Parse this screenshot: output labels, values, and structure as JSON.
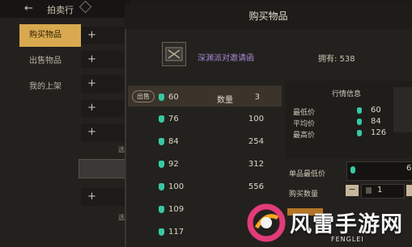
{
  "left_panel": {
    "title": "拍卖行",
    "back_icon": "←",
    "tabs": [
      {
        "label": "购买物品",
        "active": true
      },
      {
        "label": "出售物品",
        "active": false
      },
      {
        "label": "我的上架",
        "active": false
      }
    ],
    "fragments": [
      "选",
      "选"
    ]
  },
  "dialog": {
    "title": "购买物品",
    "item_name": "深渊派对邀请函",
    "owned": "拥有: 538",
    "list": {
      "pill": "出售",
      "qty_header": "数量",
      "rows": [
        {
          "price": "60",
          "qty": "3"
        },
        {
          "price": "76",
          "qty": "100"
        },
        {
          "price": "84",
          "qty": "254"
        },
        {
          "price": "92",
          "qty": "312"
        },
        {
          "price": "100",
          "qty": "556"
        },
        {
          "price": "109",
          "qty": ""
        },
        {
          "price": "117",
          "qty": ""
        }
      ]
    },
    "market": {
      "title": "行情信息",
      "min_label": "最低价",
      "min_value": "60",
      "avg_label": "平均价",
      "avg_value": "84",
      "max_label": "最高价",
      "max_value": "126"
    },
    "unit_price_label": "单品最低价",
    "unit_price_value": "6",
    "buy_qty_label": "购买数量",
    "buy_qty_value": "1",
    "minus_label": "−"
  },
  "watermark": {
    "text": "风雷手游网",
    "sub": "FENGLEI"
  },
  "colors": {
    "accent": "#d8a94e",
    "gem": "#38c9a4",
    "item_name": "#a98ad4"
  }
}
